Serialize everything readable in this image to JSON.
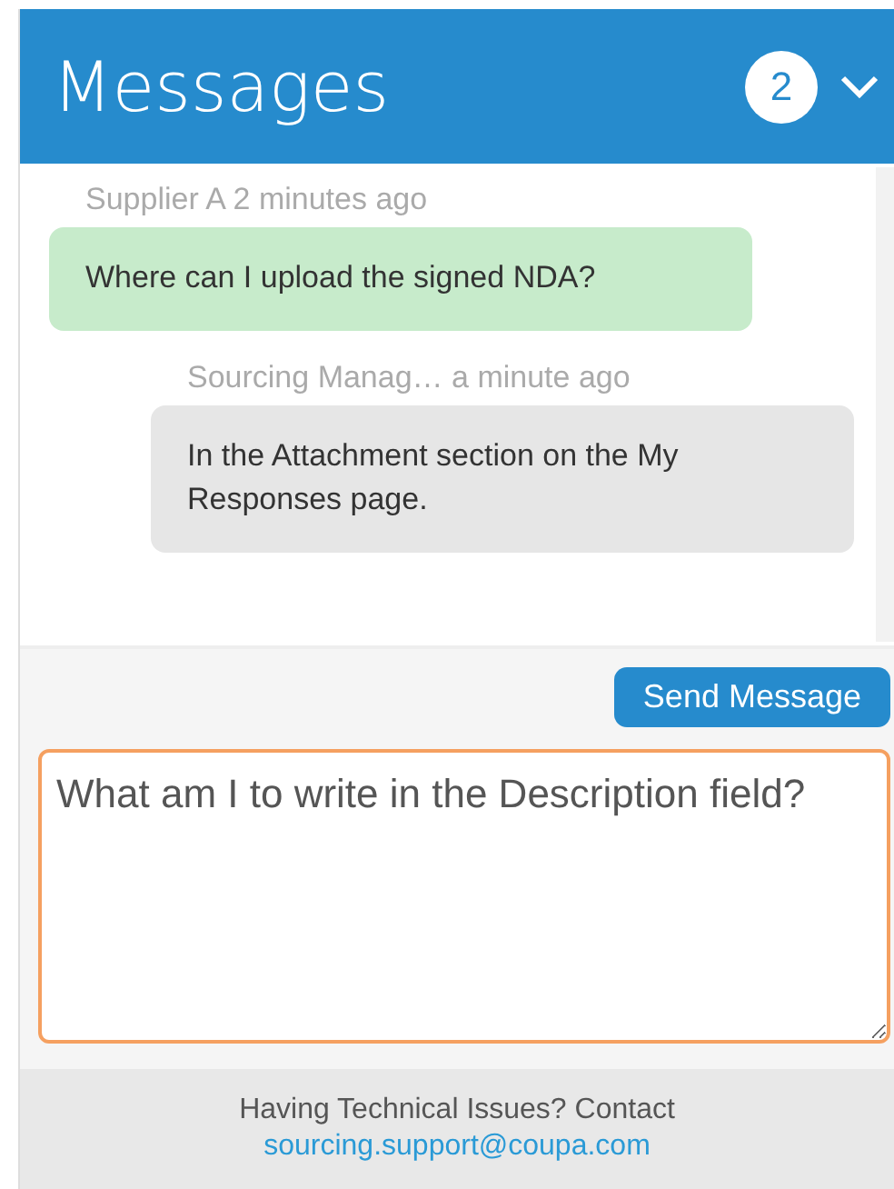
{
  "header": {
    "title": "Messages",
    "unread_count": "2"
  },
  "messages": [
    {
      "kind": "incoming",
      "meta": "Supplier A 2 minutes ago",
      "text": "Where can I upload the signed NDA?"
    },
    {
      "kind": "outgoing",
      "meta": "Sourcing Manag… a minute ago",
      "text": "In the Attachment section on the My Responses page."
    }
  ],
  "compose": {
    "button": "Send Message",
    "value": "What am I to write in the Description field?"
  },
  "footer": {
    "text": "Having Technical Issues? Contact",
    "link": "sourcing.support@coupa.com"
  }
}
